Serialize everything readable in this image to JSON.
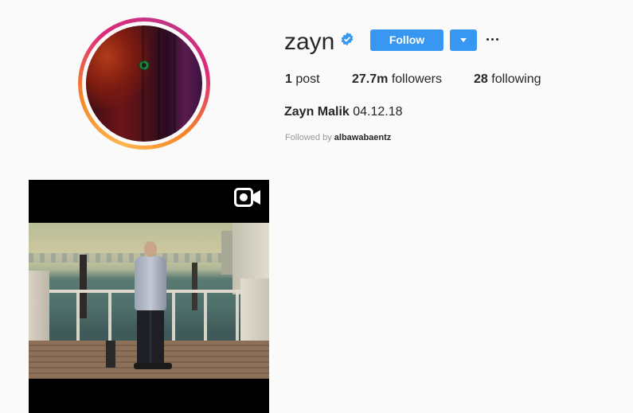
{
  "profile": {
    "username": "zayn",
    "verified": true,
    "follow_label": "Follow",
    "posts_count": "1",
    "posts_label": "post",
    "followers_count": "27.7m",
    "followers_label": "followers",
    "following_count": "28",
    "following_label": "following",
    "full_name": "Zayn Malik",
    "bio": "04.12.18",
    "followed_by_prefix": "Followed by",
    "followed_by_user": "albawabaentz"
  },
  "post": {
    "type_icon": "video-icon"
  },
  "colors": {
    "accent": "#3897f0",
    "text": "#262626",
    "muted": "#999999",
    "background": "#fafafa"
  }
}
